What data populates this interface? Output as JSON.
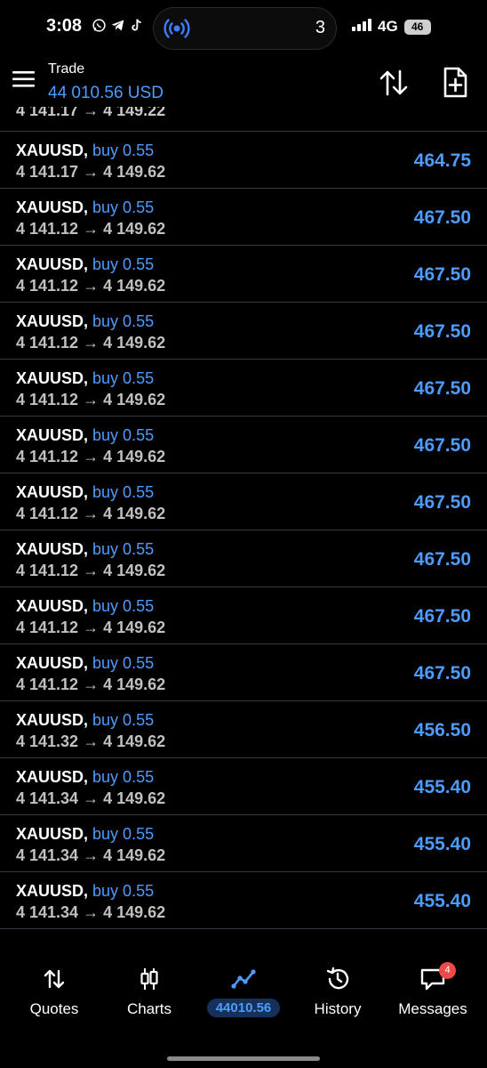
{
  "status_bar": {
    "time": "3:08",
    "apps": [
      "whatsapp-icon",
      "telegram-icon",
      "tiktok-icon"
    ],
    "island_count": "3",
    "network": "4G",
    "battery": "46"
  },
  "header": {
    "title": "Trade",
    "balance": "44 010.56 USD"
  },
  "positions": {
    "clipped_top": {
      "prices": "4 141.17 → 4 149.22"
    },
    "rows": [
      {
        "symbol": "XAUUSD,",
        "side": "buy 0.55",
        "prices": "4 141.17 → 4 149.62",
        "profit": "464.75"
      },
      {
        "symbol": "XAUUSD,",
        "side": "buy 0.55",
        "prices": "4 141.12 → 4 149.62",
        "profit": "467.50"
      },
      {
        "symbol": "XAUUSD,",
        "side": "buy 0.55",
        "prices": "4 141.12 → 4 149.62",
        "profit": "467.50"
      },
      {
        "symbol": "XAUUSD,",
        "side": "buy 0.55",
        "prices": "4 141.12 → 4 149.62",
        "profit": "467.50"
      },
      {
        "symbol": "XAUUSD,",
        "side": "buy 0.55",
        "prices": "4 141.12 → 4 149.62",
        "profit": "467.50"
      },
      {
        "symbol": "XAUUSD,",
        "side": "buy 0.55",
        "prices": "4 141.12 → 4 149.62",
        "profit": "467.50"
      },
      {
        "symbol": "XAUUSD,",
        "side": "buy 0.55",
        "prices": "4 141.12 → 4 149.62",
        "profit": "467.50"
      },
      {
        "symbol": "XAUUSD,",
        "side": "buy 0.55",
        "prices": "4 141.12 → 4 149.62",
        "profit": "467.50"
      },
      {
        "symbol": "XAUUSD,",
        "side": "buy 0.55",
        "prices": "4 141.12 → 4 149.62",
        "profit": "467.50"
      },
      {
        "symbol": "XAUUSD,",
        "side": "buy 0.55",
        "prices": "4 141.12 → 4 149.62",
        "profit": "467.50"
      },
      {
        "symbol": "XAUUSD,",
        "side": "buy 0.55",
        "prices": "4 141.32 → 4 149.62",
        "profit": "456.50"
      },
      {
        "symbol": "XAUUSD,",
        "side": "buy 0.55",
        "prices": "4 141.34 → 4 149.62",
        "profit": "455.40"
      },
      {
        "symbol": "XAUUSD,",
        "side": "buy 0.55",
        "prices": "4 141.34 → 4 149.62",
        "profit": "455.40"
      },
      {
        "symbol": "XAUUSD,",
        "side": "buy 0.55",
        "prices": "4 141.34 → 4 149.62",
        "profit": "455.40"
      }
    ]
  },
  "nav": {
    "quotes": "Quotes",
    "charts": "Charts",
    "trade": "44010.56",
    "history": "History",
    "messages": "Messages",
    "messages_badge": "4"
  },
  "colors": {
    "accent": "#4e9bff",
    "background": "#000000",
    "separator": "#333a44",
    "badge": "#ef4a4a"
  }
}
